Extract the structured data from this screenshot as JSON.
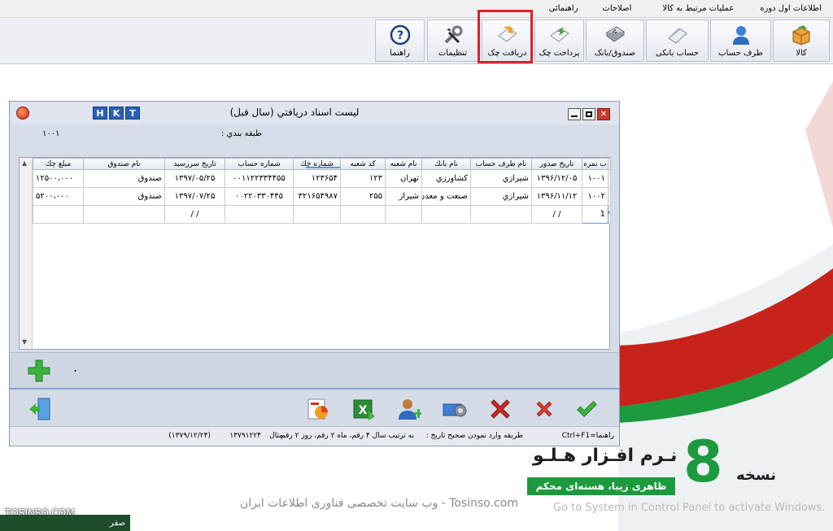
{
  "menu": [
    "اطلاعات اول دوره",
    "عملیات مرتبط به کالا",
    "اصلاحات",
    "راهنمائی"
  ],
  "toolbar": {
    "kala": "کالا",
    "taraf": "طرف حساب",
    "hesab_banki": "حساب بانکی",
    "sandogh_bank": "صندوق/بانک",
    "pardakht_chek": "پرداخت چک",
    "daryaft_chek": "دریافت چک",
    "tanzimat": "تنظیمات",
    "rahnama": "راهنما"
  },
  "dialog": {
    "title": "لیست اسناد دریافتي (سال قبل)",
    "hkt": [
      "H",
      "K",
      "T"
    ],
    "category_label": "طبقه بندي :",
    "category_value": "۱۰۰۱"
  },
  "grid": {
    "columns": [
      "ب نمره",
      "تاريخ صدور",
      "نام طرف حساب",
      "نام بانك",
      "نام شعبه",
      "كد شعبه",
      "شماره چك",
      "شماره حساب",
      "تاريخ سررسيد",
      "نام صندوق",
      "مبلغ چك"
    ],
    "rows": [
      [
        "۱۰۰۱",
        "۱۳۹۶/۱۲/۰۵",
        "شيرازي",
        "كشاورزي",
        "تهران",
        "۱۲۳",
        "۱۲۳۶۵۴",
        "۰۰۱۱۲۲۳۳۴۴۵۵",
        "۱۳۹۷/۰۵/۲۵",
        "صندوق",
        "۱۲۵۰۰،۰۰۰"
      ],
      [
        "۱۰۰۲",
        "۱۳۹۶/۱۱/۱۲",
        "شيرازي",
        "صنعت و معدن",
        "شيراز",
        "۲۵۵",
        "۳۲۱۶۵۴۹۸۷",
        "۰۰۲۲۰۳۳۰۴۴۵",
        "۱۳۹۷/۰۷/۲۵",
        "صندوق",
        "۵۲۰۰،۰۰۰"
      ],
      [
        "1",
        "/ /",
        "",
        "",
        "",
        "",
        "",
        "",
        "/ /",
        "",
        ""
      ]
    ],
    "row_markers": [
      "",
      "",
      "*"
    ]
  },
  "addbar": {
    "dot": "."
  },
  "status": {
    "help": "راهنما=Ctrl+F1",
    "hint": "طريقه وارد نمودن صحيح تاريخ :",
    "format": "به ترتيب سال ۴ رقم، ماه ۲ رقم، روز ۲ رقم",
    "example_label": "مثال",
    "example_value": "۱۳۷۹۱۲۲۴",
    "example_date": "(۱۳۷۹/۱۲/۲۴)"
  },
  "promo": {
    "title": "نـرم افـزار هـلـو",
    "version": "8",
    "nos": "نسخه",
    "subtitle": "ظاهری زیبا، هسته‌ای محکم"
  },
  "watermark": "Tosinso.com - وب سایت تخصصی فناوری اطلاعات ایران",
  "activate": "Go to System in Control Panel to activate Windows.",
  "brand": "TOSINSO.COM",
  "taskbar": "صفر",
  "colors": {
    "accent": "#2a5fb8",
    "green": "#1c9a3d",
    "red": "#c8231b",
    "highlight": "#e0202a"
  }
}
